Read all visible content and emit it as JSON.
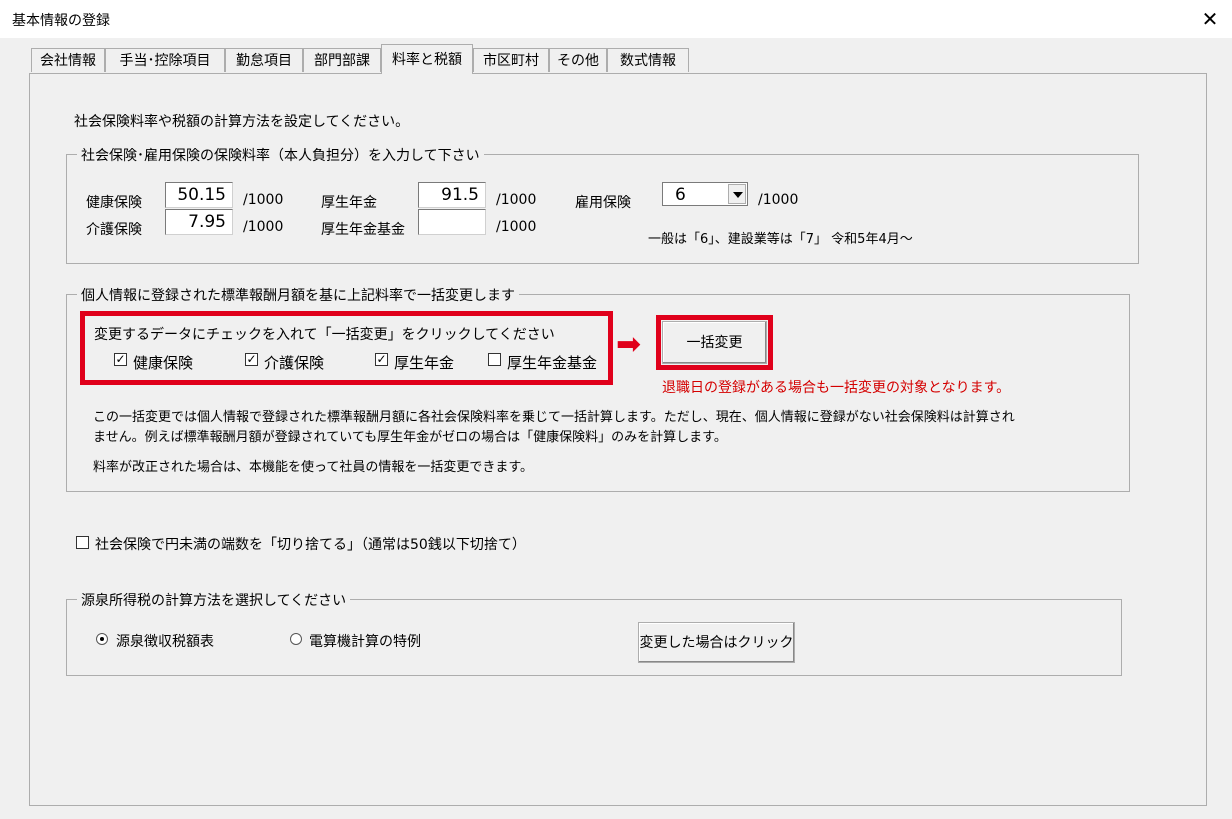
{
  "window": {
    "title": "基本情報の登録",
    "close_glyph": "✕"
  },
  "tabs": [
    "会社情報",
    "手当･控除項目",
    "勤怠項目",
    "部門部課",
    "料率と税額",
    "市区町村",
    "その他",
    "数式情報"
  ],
  "intro": "社会保険料率や税額の計算方法を設定してください。",
  "rates": {
    "legend": "社会保険･雇用保険の保険料率（本人負担分）を入力して下さい",
    "unit": "/1000",
    "kenko_label": "健康保険",
    "kenko_value": "50.15",
    "kaigo_label": "介護保険",
    "kaigo_value": "7.95",
    "kosei_label": "厚生年金",
    "kosei_value": "91.5",
    "kikin_label": "厚生年金基金",
    "kikin_value": "",
    "koyo_label": "雇用保険",
    "koyo_value": "6",
    "koyo_note": "一般は「6」、建設業等は「7」 令和5年4月～"
  },
  "bulk": {
    "legend": "個人情報に登録された標準報酬月額を基に上記料率で一括変更します",
    "instruction": "変更するデータにチェックを入れて「一括変更」をクリックしてください",
    "checks": [
      {
        "label": "健康保険",
        "checked": true
      },
      {
        "label": "介護保険",
        "checked": true
      },
      {
        "label": "厚生年金",
        "checked": true
      },
      {
        "label": "厚生年金基金",
        "checked": false
      }
    ],
    "check_glyph": "✓",
    "button_label": "一括変更",
    "arrow_glyph": "➡",
    "warning": "退職日の登録がある場合も一括変更の対象となります。",
    "desc_line1": "この一括変更では個人情報で登録された標準報酬月額に各社会保険料率を乗じて一括計算します。ただし、現在、個人情報に登録がない社会保険料は計算され",
    "desc_line2": "ません。例えば標準報酬月額が登録されていても厚生年金がゼロの場合は「健康保険料」のみを計算します。",
    "desc_line3": "料率が改正された場合は、本機能を使って社員の情報を一括変更できます。"
  },
  "rounding": {
    "label": "社会保険で円未満の端数を「切り捨てる」（通常は50銭以下切捨て）",
    "checked": false
  },
  "tax": {
    "legend": "源泉所得税の計算方法を選択してください",
    "option1": "源泉徴収税額表",
    "option2": "電算機計算の特例",
    "selected": 1,
    "button_label": "変更した場合はクリック"
  },
  "colors": {
    "accent_red": "#e0001b",
    "warning_text": "#d40000"
  }
}
